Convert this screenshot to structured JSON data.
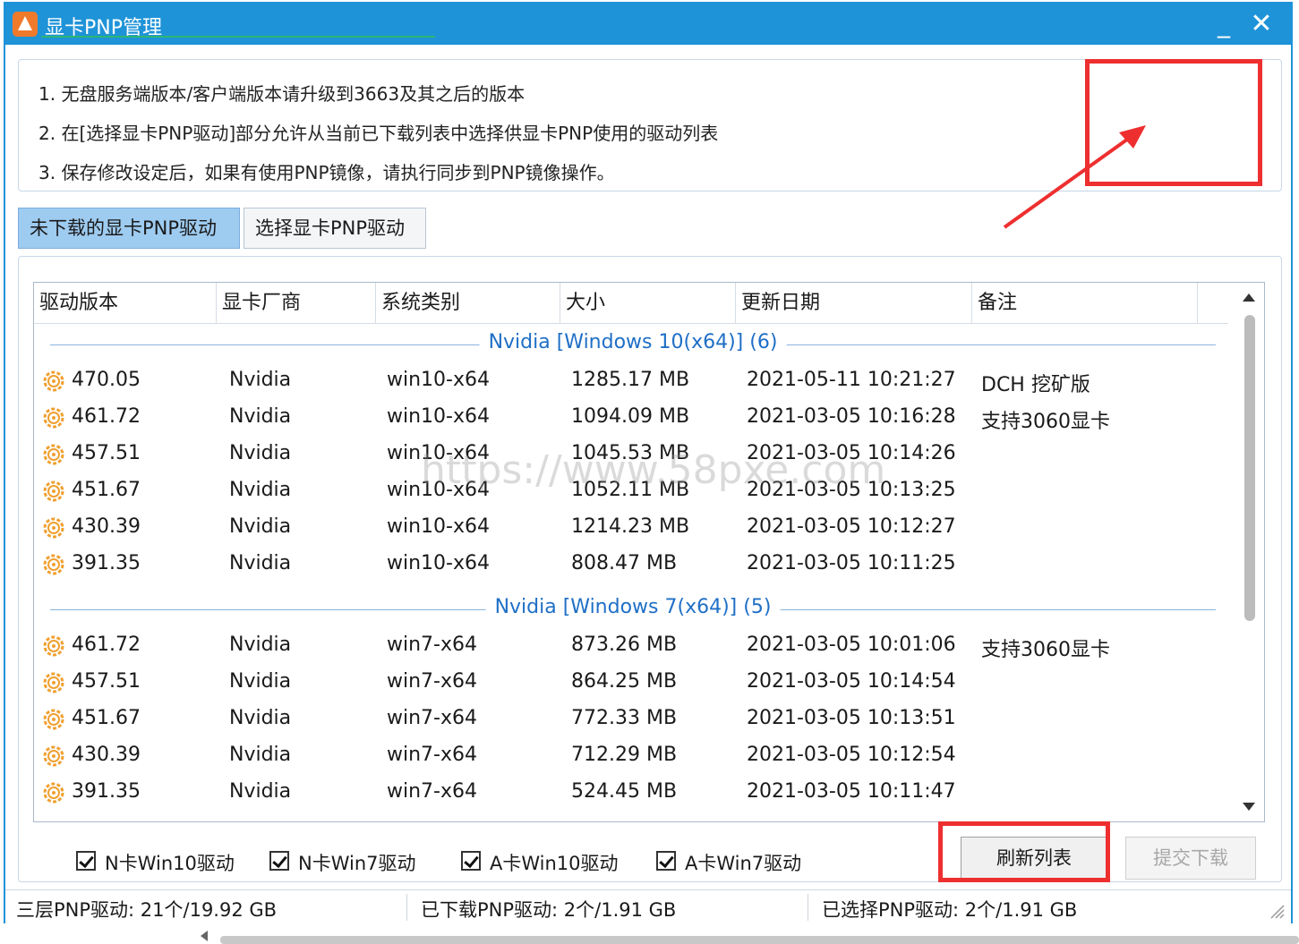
{
  "window": {
    "title": "显卡PNP管理",
    "minimize_label": "_",
    "close_label": "✕"
  },
  "notes": [
    "1. 无盘服务端版本/客户端版本请升级到3663及其之后的版本",
    "2. 在[选择显卡PNP驱动]部分允许从当前已下载列表中选择供显卡PNP使用的驱动列表",
    "3. 保存修改设定后，如果有使用PNP镜像，请执行同步到PNP镜像操作。"
  ],
  "tabs": [
    {
      "label": "未下载的显卡PNP驱动",
      "active": true
    },
    {
      "label": "选择显卡PNP驱动",
      "active": false
    }
  ],
  "table": {
    "columns": [
      "驱动版本",
      "显卡厂商",
      "系统类别",
      "大小",
      "更新日期",
      "备注"
    ],
    "groups": [
      {
        "label": "Nvidia [Windows 10(x64)] (6)",
        "rows": [
          {
            "version": "470.05",
            "vendor": "Nvidia",
            "os": "win10-x64",
            "size": "1285.17 MB",
            "date": "2021-05-11 10:21:27",
            "note": "DCH  挖矿版"
          },
          {
            "version": "461.72",
            "vendor": "Nvidia",
            "os": "win10-x64",
            "size": "1094.09 MB",
            "date": "2021-03-05 10:16:28",
            "note": "支持3060显卡"
          },
          {
            "version": "457.51",
            "vendor": "Nvidia",
            "os": "win10-x64",
            "size": "1045.53 MB",
            "date": "2021-03-05 10:14:26",
            "note": ""
          },
          {
            "version": "451.67",
            "vendor": "Nvidia",
            "os": "win10-x64",
            "size": "1052.11 MB",
            "date": "2021-03-05 10:13:25",
            "note": ""
          },
          {
            "version": "430.39",
            "vendor": "Nvidia",
            "os": "win10-x64",
            "size": "1214.23 MB",
            "date": "2021-03-05 10:12:27",
            "note": ""
          },
          {
            "version": "391.35",
            "vendor": "Nvidia",
            "os": "win10-x64",
            "size": "808.47 MB",
            "date": "2021-03-05 10:11:25",
            "note": ""
          }
        ]
      },
      {
        "label": "Nvidia [Windows 7(x64)] (5)",
        "rows": [
          {
            "version": "461.72",
            "vendor": "Nvidia",
            "os": "win7-x64",
            "size": "873.26 MB",
            "date": "2021-03-05 10:01:06",
            "note": "支持3060显卡"
          },
          {
            "version": "457.51",
            "vendor": "Nvidia",
            "os": "win7-x64",
            "size": "864.25 MB",
            "date": "2021-03-05 10:14:54",
            "note": ""
          },
          {
            "version": "451.67",
            "vendor": "Nvidia",
            "os": "win7-x64",
            "size": "772.33 MB",
            "date": "2021-03-05 10:13:51",
            "note": ""
          },
          {
            "version": "430.39",
            "vendor": "Nvidia",
            "os": "win7-x64",
            "size": "712.29 MB",
            "date": "2021-03-05 10:12:54",
            "note": ""
          },
          {
            "version": "391.35",
            "vendor": "Nvidia",
            "os": "win7-x64",
            "size": "524.45 MB",
            "date": "2021-03-05 10:11:47",
            "note": ""
          }
        ]
      }
    ]
  },
  "filters": [
    {
      "label": "N卡Win10驱动",
      "checked": true
    },
    {
      "label": "N卡Win7驱动",
      "checked": true
    },
    {
      "label": "A卡Win10驱动",
      "checked": true
    },
    {
      "label": "A卡Win7驱动",
      "checked": true
    }
  ],
  "buttons": {
    "refresh": "刷新列表",
    "submit": "提交下载"
  },
  "status": {
    "total": "三层PNP驱动: 21个/19.92 GB",
    "downloaded": "已下载PNP驱动: 2个/1.91 GB",
    "selected": "已选择PNP驱动: 2个/1.91 GB"
  },
  "watermark": "https://www.58pxe.com",
  "colors": {
    "titlebar": "#1f93d8",
    "active_tab": "#9ecbf0",
    "highlight": "#ee2f2f",
    "group_label": "#1f6fc6"
  }
}
